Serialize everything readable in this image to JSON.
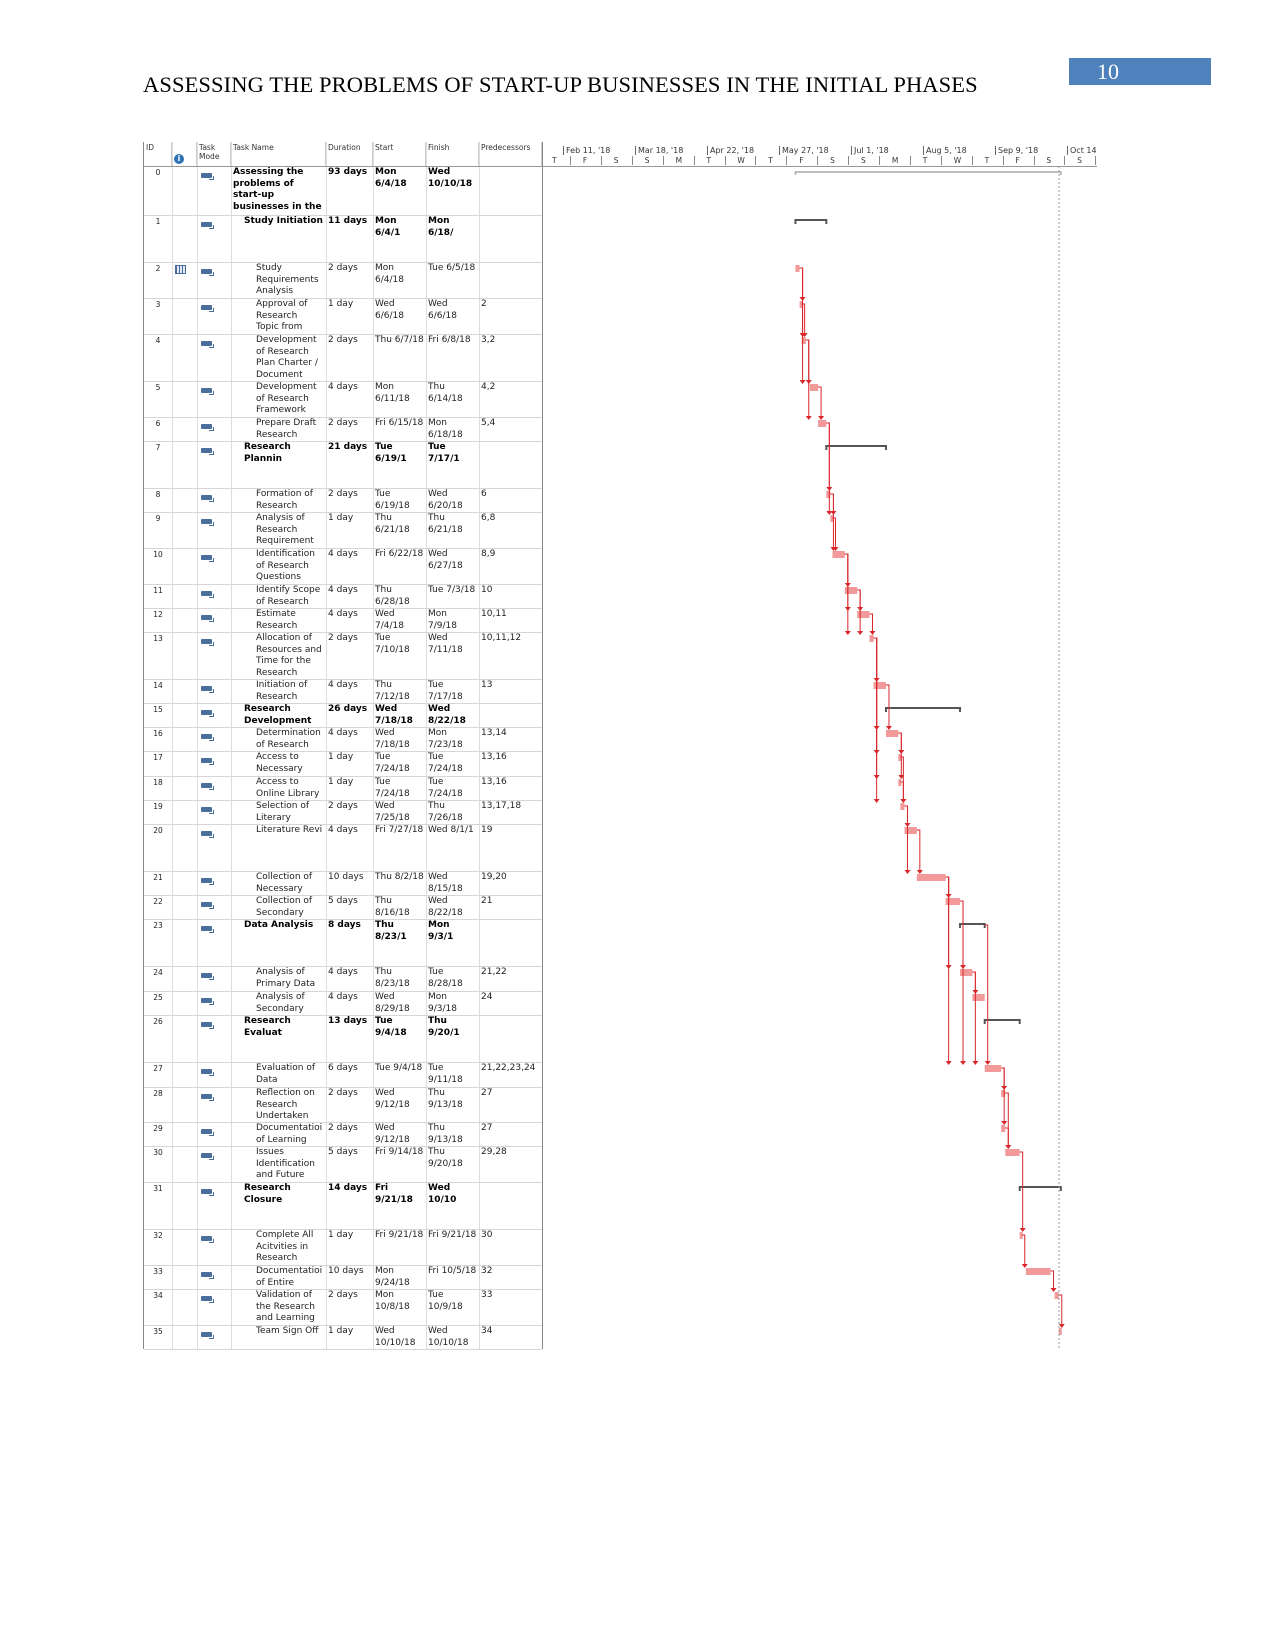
{
  "page": {
    "running_head": "ASSESSING THE PROBLEMS OF START-UP BUSINESSES IN THE INITIAL PHASES",
    "page_number": "10"
  },
  "gantt": {
    "headers": {
      "id": "ID",
      "mode": "Task\nMode",
      "name": "Task Name",
      "duration": "Duration",
      "start": "Start",
      "finish": "Finish",
      "pred": "Predecessors"
    },
    "timeline_top": [
      "Feb 11, '18",
      "Mar 18, '18",
      "Apr 22, '18",
      "May 27, '18",
      "Jul 1, '18",
      "Aug 5, '18",
      "Sep 9, '18",
      "Oct 14"
    ],
    "timeline_bottom": [
      "T",
      "F",
      "S",
      "S",
      "M",
      "T",
      "W",
      "T",
      "F",
      "S",
      "S",
      "M",
      "T",
      "W",
      "T",
      "F",
      "S",
      "S"
    ],
    "colors": {
      "task_bar": "#f29a9a",
      "link": "#d9262b",
      "summary": "#555555",
      "header_box": "#4f81bd"
    },
    "rows": [
      {
        "id": "0",
        "level": 0,
        "summary": true,
        "name": "Assessing the\nproblems of\nstart-up\nbusinesses in the",
        "duration": "93 days",
        "start": "Mon\n6/4/18",
        "finish": "Wed\n10/10/18",
        "pred": ""
      },
      {
        "id": "1",
        "level": 1,
        "summary": true,
        "name": "Study Initiation",
        "duration": "11 days",
        "start": "Mon 6/4/1",
        "finish": "Mon 6/18/",
        "pred": ""
      },
      {
        "id": "2",
        "level": 2,
        "summary": false,
        "calendar": true,
        "name": "Study\nRequirements\nAnalysis",
        "duration": "2 days",
        "start": "Mon\n6/4/18",
        "finish": "Tue 6/5/18",
        "pred": ""
      },
      {
        "id": "3",
        "level": 2,
        "summary": false,
        "name": "Approval of\nResearch\nTopic from",
        "duration": "1 day",
        "start": "Wed\n6/6/18",
        "finish": "Wed\n6/6/18",
        "pred": "2"
      },
      {
        "id": "4",
        "level": 2,
        "summary": false,
        "name": "Development\nof Research\nPlan Charter /\nDocument",
        "duration": "2 days",
        "start": "Thu 6/7/18",
        "finish": "Fri 6/8/18",
        "pred": "3,2"
      },
      {
        "id": "5",
        "level": 2,
        "summary": false,
        "name": "Development\nof Research\nFramework",
        "duration": "4 days",
        "start": "Mon\n6/11/18",
        "finish": "Thu\n6/14/18",
        "pred": "4,2"
      },
      {
        "id": "6",
        "level": 2,
        "summary": false,
        "name": "Prepare Draft\nResearch",
        "duration": "2 days",
        "start": "Fri 6/15/18",
        "finish": "Mon\n6/18/18",
        "pred": "5,4"
      },
      {
        "id": "7",
        "level": 1,
        "summary": true,
        "name": "Research Plannin",
        "duration": "21 days",
        "start": "Tue 6/19/1",
        "finish": "Tue 7/17/1",
        "pred": ""
      },
      {
        "id": "8",
        "level": 2,
        "summary": false,
        "name": "Formation of\nResearch",
        "duration": "2 days",
        "start": "Tue\n6/19/18",
        "finish": "Wed\n6/20/18",
        "pred": "6"
      },
      {
        "id": "9",
        "level": 2,
        "summary": false,
        "name": "Analysis of\nResearch\nRequirement",
        "duration": "1 day",
        "start": "Thu\n6/21/18",
        "finish": "Thu\n6/21/18",
        "pred": "6,8"
      },
      {
        "id": "10",
        "level": 2,
        "summary": false,
        "name": "Identification\nof Research\nQuestions",
        "duration": "4 days",
        "start": "Fri 6/22/18",
        "finish": "Wed\n6/27/18",
        "pred": "8,9"
      },
      {
        "id": "11",
        "level": 2,
        "summary": false,
        "name": "Identify Scope\nof Research",
        "duration": "4 days",
        "start": "Thu\n6/28/18",
        "finish": "Tue 7/3/18",
        "pred": "10"
      },
      {
        "id": "12",
        "level": 2,
        "summary": false,
        "name": "Estimate\nResearch",
        "duration": "4 days",
        "start": "Wed\n7/4/18",
        "finish": "Mon\n7/9/18",
        "pred": "10,11"
      },
      {
        "id": "13",
        "level": 2,
        "summary": false,
        "name": "Allocation of\nResources and\nTime for the\nResearch",
        "duration": "2 days",
        "start": "Tue\n7/10/18",
        "finish": "Wed\n7/11/18",
        "pred": "10,11,12"
      },
      {
        "id": "14",
        "level": 2,
        "summary": false,
        "name": "Initiation of\nResearch",
        "duration": "4 days",
        "start": "Thu\n7/12/18",
        "finish": "Tue\n7/17/18",
        "pred": "13"
      },
      {
        "id": "15",
        "level": 1,
        "summary": true,
        "name": "Research\nDevelopment",
        "duration": "26 days",
        "start": "Wed\n7/18/18",
        "finish": "Wed\n8/22/18",
        "pred": ""
      },
      {
        "id": "16",
        "level": 2,
        "summary": false,
        "name": "Determination\nof Research",
        "duration": "4 days",
        "start": "Wed\n7/18/18",
        "finish": "Mon\n7/23/18",
        "pred": "13,14"
      },
      {
        "id": "17",
        "level": 2,
        "summary": false,
        "name": "Access to\nNecessary",
        "duration": "1 day",
        "start": "Tue\n7/24/18",
        "finish": "Tue\n7/24/18",
        "pred": "13,16"
      },
      {
        "id": "18",
        "level": 2,
        "summary": false,
        "name": "Access to\nOnline Library",
        "duration": "1 day",
        "start": "Tue\n7/24/18",
        "finish": "Tue\n7/24/18",
        "pred": "13,16"
      },
      {
        "id": "19",
        "level": 2,
        "summary": false,
        "name": "Selection of\nLiterary",
        "duration": "2 days",
        "start": "Wed\n7/25/18",
        "finish": "Thu\n7/26/18",
        "pred": "13,17,18"
      },
      {
        "id": "20",
        "level": 2,
        "summary": false,
        "name": "Literature Revi",
        "duration": "4 days",
        "start": "Fri 7/27/18",
        "finish": "Wed 8/1/1",
        "pred": "19"
      },
      {
        "id": "21",
        "level": 2,
        "summary": false,
        "name": "Collection of\nNecessary",
        "duration": "10 days",
        "start": "Thu 8/2/18",
        "finish": "Wed\n8/15/18",
        "pred": "19,20"
      },
      {
        "id": "22",
        "level": 2,
        "summary": false,
        "name": "Collection of\nSecondary",
        "duration": "5 days",
        "start": "Thu\n8/16/18",
        "finish": "Wed\n8/22/18",
        "pred": "21"
      },
      {
        "id": "23",
        "level": 1,
        "summary": true,
        "name": "Data Analysis",
        "duration": "8 days",
        "start": "Thu 8/23/1",
        "finish": "Mon 9/3/1",
        "pred": ""
      },
      {
        "id": "24",
        "level": 2,
        "summary": false,
        "name": "Analysis of\nPrimary Data",
        "duration": "4 days",
        "start": "Thu\n8/23/18",
        "finish": "Tue\n8/28/18",
        "pred": "21,22"
      },
      {
        "id": "25",
        "level": 2,
        "summary": false,
        "name": "Analysis of\nSecondary",
        "duration": "4 days",
        "start": "Wed\n8/29/18",
        "finish": "Mon\n9/3/18",
        "pred": "24"
      },
      {
        "id": "26",
        "level": 1,
        "summary": true,
        "name": "Research Evaluat",
        "duration": "13 days",
        "start": "Tue 9/4/18",
        "finish": "Thu 9/20/1",
        "pred": ""
      },
      {
        "id": "27",
        "level": 2,
        "summary": false,
        "name": "Evaluation of\nData",
        "duration": "6 days",
        "start": "Tue 9/4/18",
        "finish": "Tue\n9/11/18",
        "pred": "21,22,23,24"
      },
      {
        "id": "28",
        "level": 2,
        "summary": false,
        "name": "Reflection on\nResearch\nUndertaken",
        "duration": "2 days",
        "start": "Wed\n9/12/18",
        "finish": "Thu\n9/13/18",
        "pred": "27"
      },
      {
        "id": "29",
        "level": 2,
        "summary": false,
        "name": "Documentatioi\nof Learning",
        "duration": "2 days",
        "start": "Wed\n9/12/18",
        "finish": "Thu\n9/13/18",
        "pred": "27"
      },
      {
        "id": "30",
        "level": 2,
        "summary": false,
        "name": "Issues\nIdentification\nand Future",
        "duration": "5 days",
        "start": "Fri 9/14/18",
        "finish": "Thu\n9/20/18",
        "pred": "29,28"
      },
      {
        "id": "31",
        "level": 1,
        "summary": true,
        "name": "Research Closure",
        "duration": "14 days",
        "start": "Fri 9/21/18",
        "finish": "Wed 10/10",
        "pred": ""
      },
      {
        "id": "32",
        "level": 2,
        "summary": false,
        "name": "Complete All\nAcitvities in\nResearch",
        "duration": "1 day",
        "start": "Fri 9/21/18",
        "finish": "Fri 9/21/18",
        "pred": "30"
      },
      {
        "id": "33",
        "level": 2,
        "summary": false,
        "name": "Documentatioi\nof Entire",
        "duration": "10 days",
        "start": "Mon\n9/24/18",
        "finish": "Fri 10/5/18",
        "pred": "32"
      },
      {
        "id": "34",
        "level": 2,
        "summary": false,
        "name": "Validation of\nthe Research\nand Learning",
        "duration": "2 days",
        "start": "Mon\n10/8/18",
        "finish": "Tue\n10/9/18",
        "pred": "33"
      },
      {
        "id": "35",
        "level": 2,
        "summary": false,
        "name": "Team Sign Off",
        "duration": "1 day",
        "start": "Wed\n10/10/18",
        "finish": "Wed\n10/10/18",
        "pred": "34"
      }
    ]
  }
}
